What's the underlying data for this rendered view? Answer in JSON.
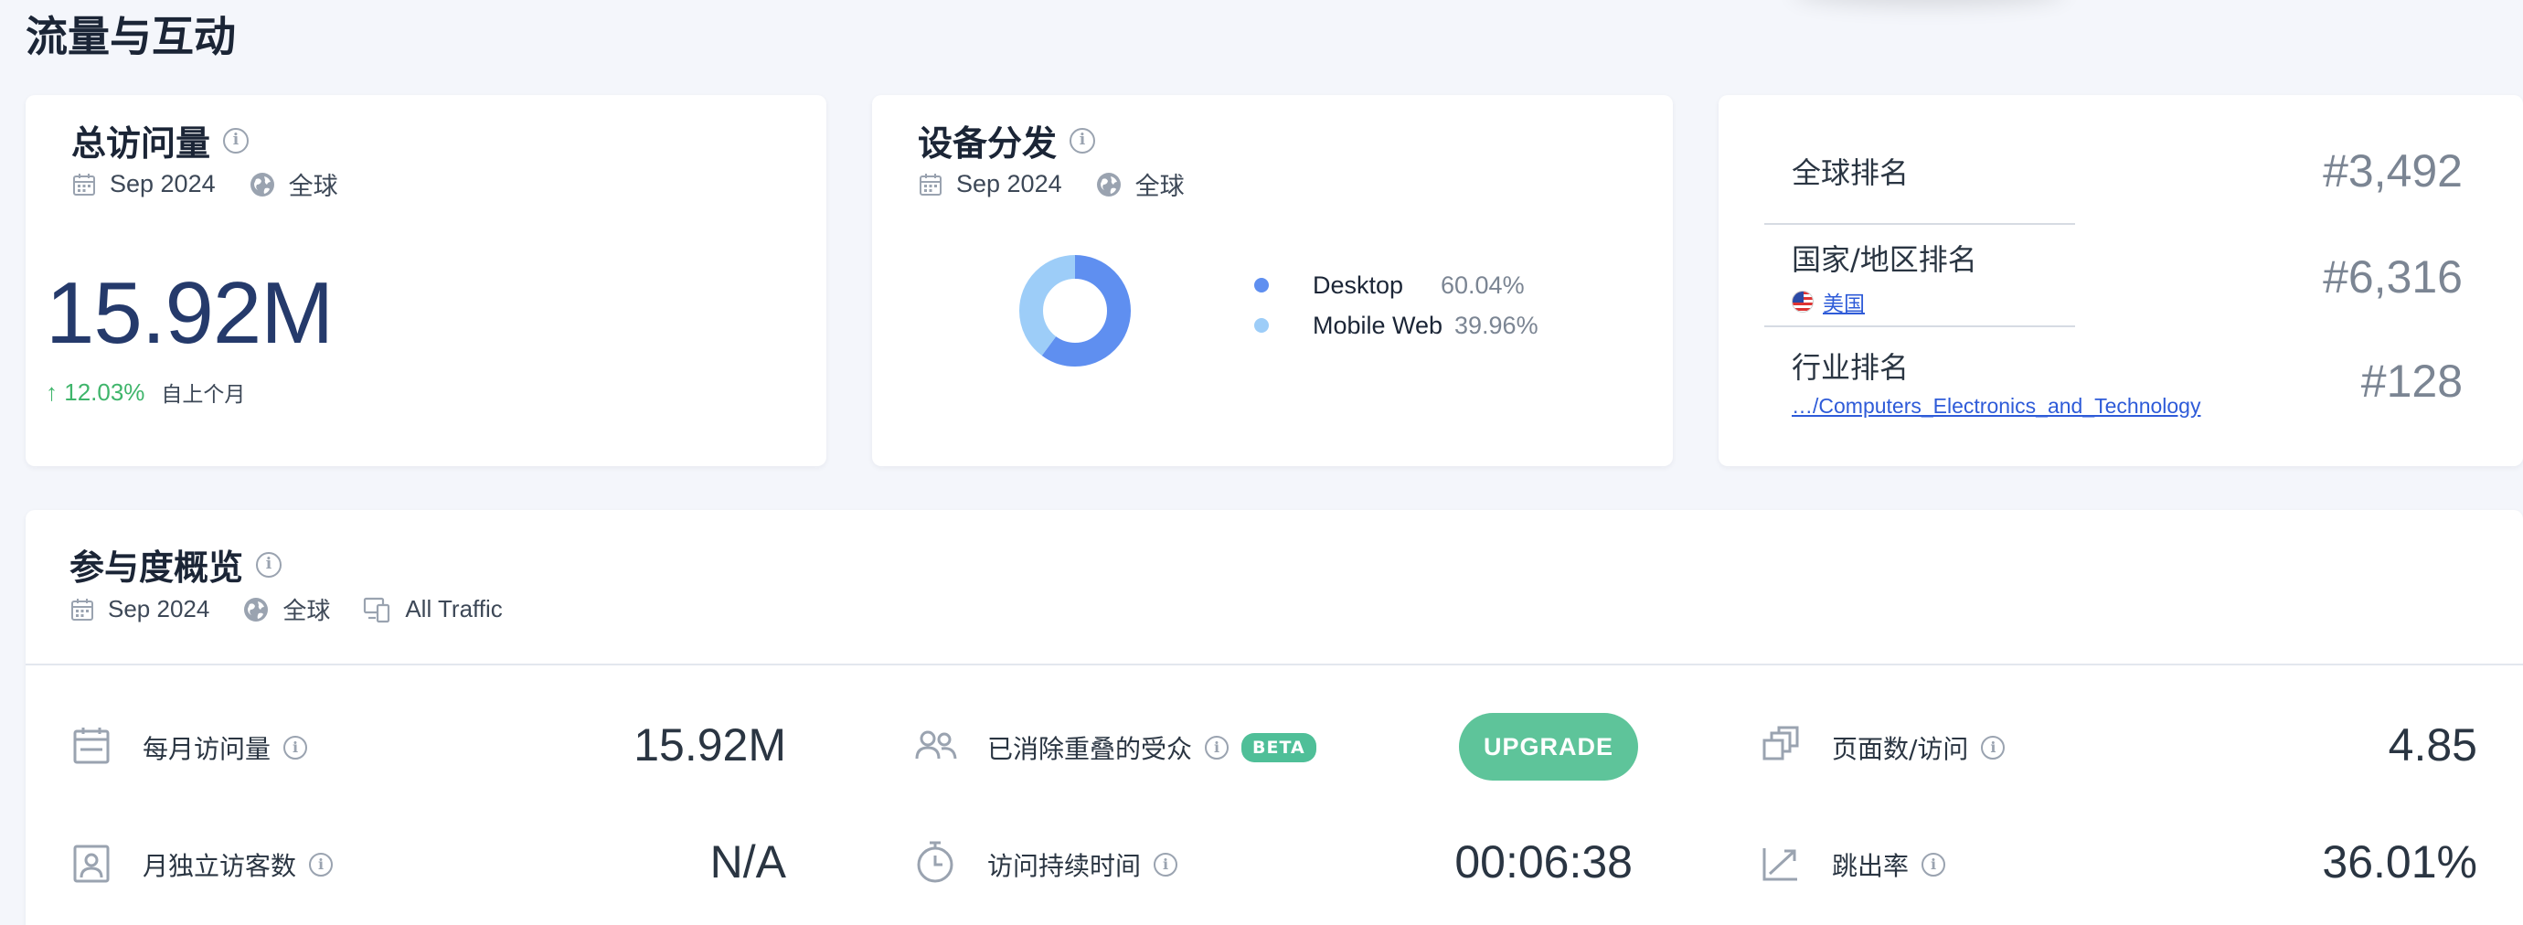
{
  "page_title": "流量与互动",
  "total_visits": {
    "title": "总访问量",
    "date": "Sep 2024",
    "region": "全球",
    "value": "15.92M",
    "delta": "12.03%",
    "delta_note": "自上个月"
  },
  "device": {
    "title": "设备分发",
    "date": "Sep 2024",
    "region": "全球",
    "items": [
      {
        "name": "Desktop",
        "pct": "60.04%",
        "value": 60.04,
        "color": "#5f8ff0"
      },
      {
        "name": "Mobile Web",
        "pct": "39.96%",
        "value": 39.96,
        "color": "#9dcdf8"
      }
    ]
  },
  "ranks": {
    "global_label": "全球排名",
    "global_value": "#3,492",
    "country_label": "国家/地区排名",
    "country_link": "美国",
    "country_value": "#6,316",
    "industry_label": "行业排名",
    "industry_link": "…/Computers_Electronics_and_Technology",
    "industry_value": "#128"
  },
  "engagement": {
    "title": "参与度概览",
    "date": "Sep 2024",
    "region": "全球",
    "traffic": "All Traffic",
    "monthly_visits_label": "每月访问量",
    "monthly_visits_value": "15.92M",
    "unique_visitors_label": "月独立访客数",
    "unique_visitors_value": "N/A",
    "dedup_label": "已消除重叠的受众",
    "beta": "BETA",
    "upgrade": "UPGRADE",
    "duration_label": "访问持续时间",
    "duration_value": "00:06:38",
    "pages_label": "页面数/访问",
    "pages_value": "4.85",
    "bounce_label": "跳出率",
    "bounce_value": "36.01%"
  },
  "colors": {
    "accent": "#253a6b",
    "positive": "#3fb56b",
    "upgrade": "#5ec49a",
    "link": "#2e5bd8"
  }
}
